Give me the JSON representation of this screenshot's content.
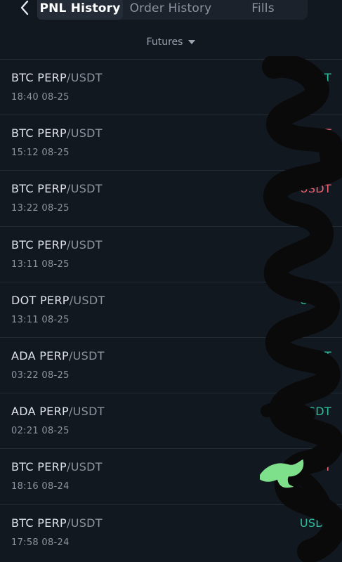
{
  "tabs": [
    {
      "label": "PNL History",
      "active": true
    },
    {
      "label": "Order History",
      "active": false
    },
    {
      "label": "Fills",
      "active": false
    }
  ],
  "filter": {
    "label": "Futures"
  },
  "colors": {
    "positive": "#2ebd98",
    "negative": "#f0616d",
    "background": "#121820"
  },
  "rows": [
    {
      "base": "BTC PERP",
      "quote": "/USDT",
      "time": "18:40 08-25",
      "pnl": "USDT",
      "sign": "positive"
    },
    {
      "base": "BTC PERP",
      "quote": "/USDT",
      "time": "15:12 08-25",
      "pnl": "USDT",
      "sign": "negative"
    },
    {
      "base": "BTC PERP",
      "quote": "/USDT",
      "time": "13:22 08-25",
      "pnl": "USDT",
      "sign": "negative"
    },
    {
      "base": "BTC PERP",
      "quote": "/USDT",
      "time": "13:11 08-25",
      "pnl": "USDT",
      "sign": "positive"
    },
    {
      "base": "DOT PERP",
      "quote": "/USDT",
      "time": "13:11 08-25",
      "pnl": "USDT",
      "sign": "positive"
    },
    {
      "base": "ADA PERP",
      "quote": "/USDT",
      "time": "03:22 08-25",
      "pnl": "USDT",
      "sign": "positive"
    },
    {
      "base": "ADA PERP",
      "quote": "/USDT",
      "time": "02:21 08-25",
      "pnl": "USDT",
      "sign": "positive"
    },
    {
      "base": "BTC PERP",
      "quote": "/USDT",
      "time": "18:16 08-24",
      "pnl": "USDT",
      "sign": "negative"
    },
    {
      "base": "BTC PERP",
      "quote": "/USDT",
      "time": "17:58 08-24",
      "pnl": "USDT",
      "sign": "positive"
    }
  ]
}
